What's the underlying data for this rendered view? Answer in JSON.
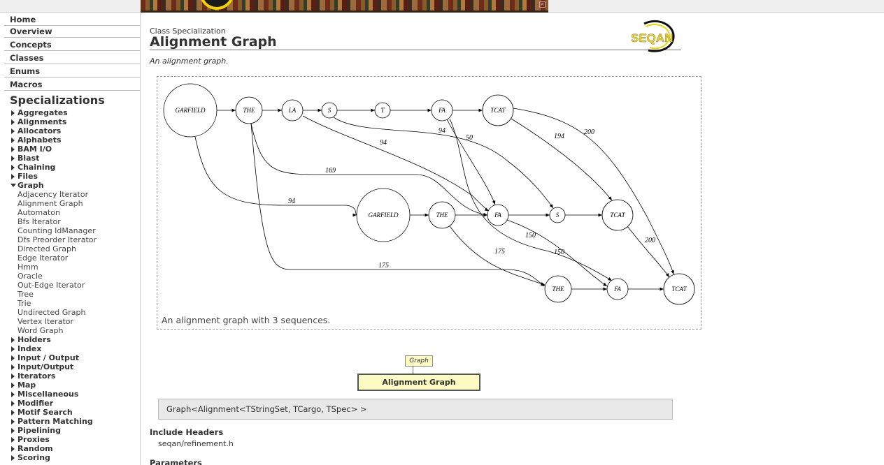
{
  "nav": {
    "home": "Home",
    "overview": "Overview",
    "concepts": "Concepts",
    "classes": "Classes",
    "enums": "Enums",
    "macros": "Macros"
  },
  "sidebar": {
    "heading": "Specializations",
    "tree": [
      {
        "label": "Aggregates",
        "expanded": false
      },
      {
        "label": "Alignments",
        "expanded": false
      },
      {
        "label": "Allocators",
        "expanded": false
      },
      {
        "label": "Alphabets",
        "expanded": false
      },
      {
        "label": "BAM I/O",
        "expanded": false
      },
      {
        "label": "Blast",
        "expanded": false
      },
      {
        "label": "Chaining",
        "expanded": false
      },
      {
        "label": "Files",
        "expanded": false
      },
      {
        "label": "Graph",
        "expanded": true
      }
    ],
    "graph_children": [
      "Adjacency Iterator",
      "Alignment Graph",
      "Automaton",
      "Bfs Iterator",
      "Counting IdManager",
      "Dfs Preorder Iterator",
      "Directed Graph",
      "Edge Iterator",
      "Hmm",
      "Oracle",
      "Out-Edge Iterator",
      "Tree",
      "Trie",
      "Undirected Graph",
      "Vertex Iterator",
      "Word Graph"
    ],
    "tree_after": [
      "Holders",
      "Index",
      "Input / Output",
      "Input/Output",
      "Iterators",
      "Map",
      "Miscellaneous",
      "Modifier",
      "Motif Search",
      "Pattern Matching",
      "Pipelining",
      "Proxies",
      "Random",
      "Scoring"
    ]
  },
  "header": {
    "kind": "Class Specialization",
    "title": "Alignment Graph",
    "logo_text": "SEQAN"
  },
  "summary": "An alignment graph.",
  "figure": {
    "caption": "An alignment graph with 3 sequences.",
    "nodes": [
      {
        "id": "n1",
        "label": "GARFIELD"
      },
      {
        "id": "n2",
        "label": "THE"
      },
      {
        "id": "n3",
        "label": "LA"
      },
      {
        "id": "n4",
        "label": "S"
      },
      {
        "id": "n5",
        "label": "T"
      },
      {
        "id": "n6",
        "label": "FA"
      },
      {
        "id": "n7",
        "label": "TCAT"
      },
      {
        "id": "n8",
        "label": "GARFIELD"
      },
      {
        "id": "n9",
        "label": "THE"
      },
      {
        "id": "n10",
        "label": "FA"
      },
      {
        "id": "n11",
        "label": "S"
      },
      {
        "id": "n12",
        "label": "TCAT"
      },
      {
        "id": "n13",
        "label": "THE"
      },
      {
        "id": "n14",
        "label": "FA"
      },
      {
        "id": "n15",
        "label": "TCAT"
      }
    ],
    "edge_labels": [
      "94",
      "94",
      "50",
      "194",
      "200",
      "169",
      "94",
      "150",
      "150",
      "175",
      "200",
      "175"
    ]
  },
  "hierarchy": {
    "parent": "Graph",
    "current": "Alignment Graph"
  },
  "signature": "Graph<Alignment<TStringSet, TCargo, TSpec> >",
  "include": {
    "heading": "Include Headers",
    "file": "seqan/refinement.h"
  },
  "params_heading": "Parameters",
  "colors": {
    "hierarchy_box": "#fdfbc4",
    "signature_bg": "#e8e8e8",
    "logo_yellow": "#f2d200"
  }
}
